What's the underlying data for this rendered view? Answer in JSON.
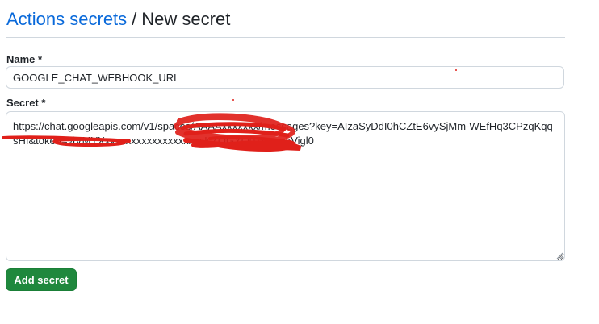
{
  "breadcrumb": {
    "parent_label": "Actions secrets",
    "separator": "/",
    "current_label": "New secret"
  },
  "form": {
    "name_label": "Name *",
    "name_value": "GOOGLE_CHAT_WEBHOOK_URL",
    "secret_label": "Secret *",
    "secret_value": "https://chat.googleapis.com/v1/spaces/AAAAxxxxxxx/messages?key=AIzaSyDdI0hCZtE6vySjMm-WEfHq3CPzqKqqsHI&token=vjVMYXxxxxxxxxxxxxxxxxxxxKZOGYO0Tge-mkVigl0",
    "submit_label": "Add secret"
  },
  "colors": {
    "link": "#0969da",
    "primary_button": "#1f883d",
    "redaction": "#e0201a"
  }
}
